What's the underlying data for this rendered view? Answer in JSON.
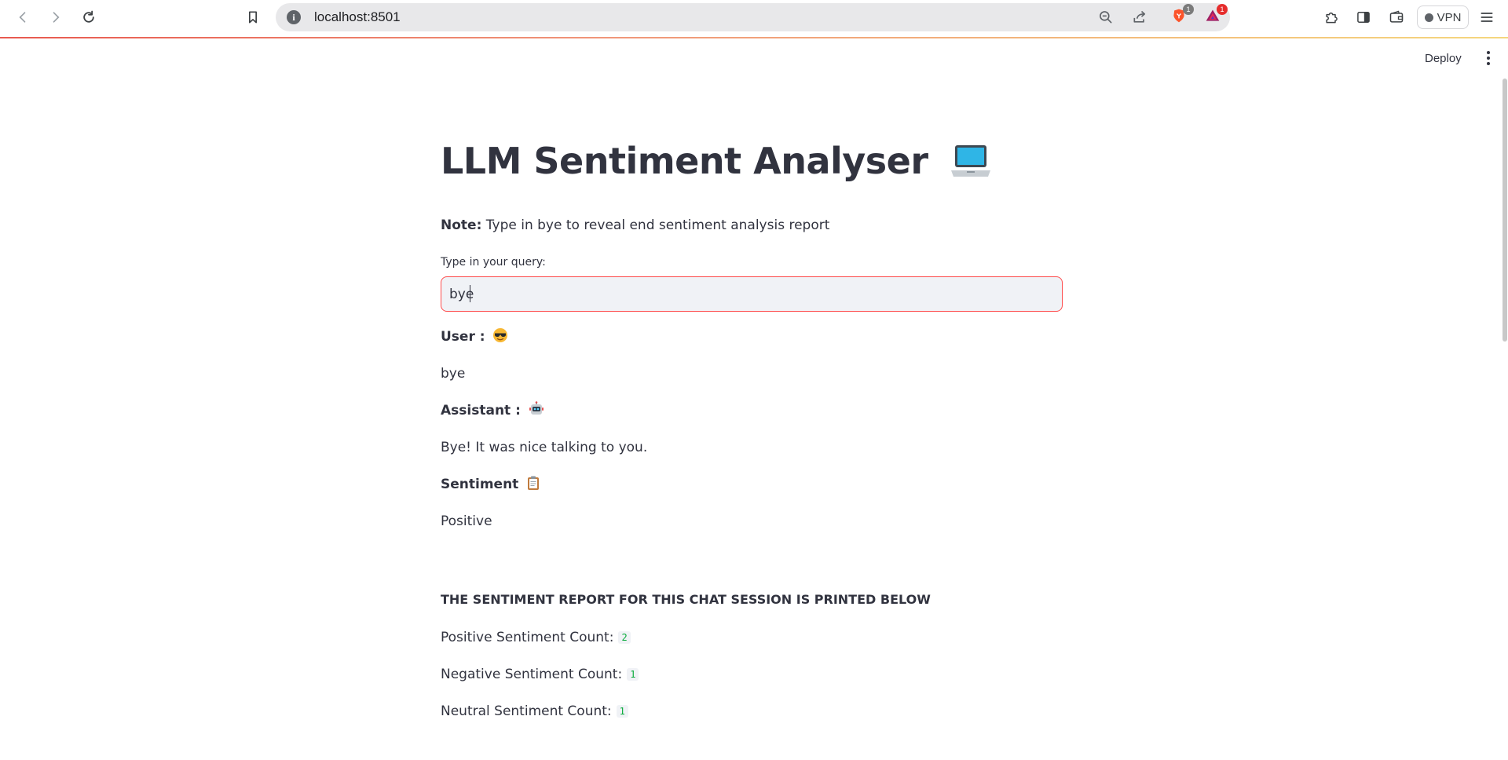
{
  "browser": {
    "url": "localhost:8501",
    "brave_badge_count": "1",
    "rewards_badge_count": "1",
    "vpn_label": "VPN"
  },
  "app_header": {
    "deploy_label": "Deploy"
  },
  "main": {
    "title": "LLM Sentiment Analyser",
    "title_emoji": "laptop-icon",
    "note_label": "Note:",
    "note_text": "Type in bye to reveal end sentiment analysis report",
    "input_label": "Type in your query:",
    "input_value": "bye",
    "user_label": "User :",
    "user_emoji": "sunglasses-face-icon",
    "user_message": "bye",
    "assistant_label": "Assistant :",
    "assistant_emoji": "robot-icon",
    "assistant_message": "Bye! It was nice talking to you.",
    "sentiment_label": "Sentiment",
    "sentiment_emoji": "clipboard-icon",
    "sentiment_value": "Positive",
    "report_header": "THE SENTIMENT REPORT FOR THIS CHAT SESSION IS PRINTED BELOW",
    "counts": [
      {
        "label": "Positive Sentiment Count:",
        "value": "2"
      },
      {
        "label": "Negative Sentiment Count:",
        "value": "1"
      },
      {
        "label": "Neutral Sentiment Count:",
        "value": "1"
      }
    ]
  },
  "colors": {
    "accent": "#ff4b4b",
    "text": "#31333f",
    "input_bg": "#f0f2f6",
    "code_green": "#09ab3b"
  }
}
